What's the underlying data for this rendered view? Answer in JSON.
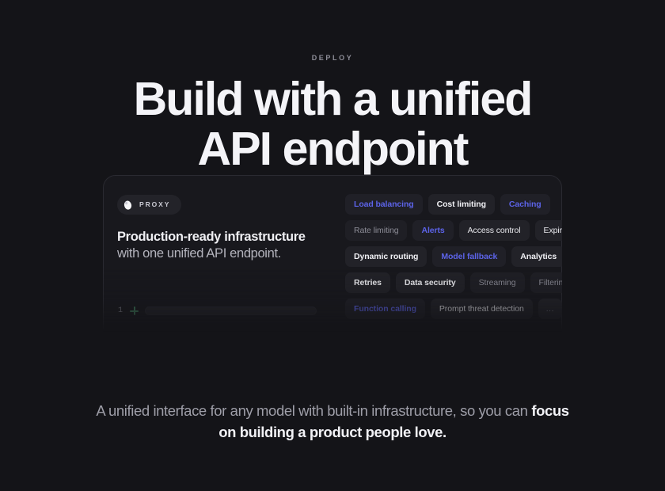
{
  "hero": {
    "eyebrow": "DEPLOY",
    "title_line1": "Build with a unified",
    "title_line2": "API endpoint"
  },
  "card": {
    "brand": {
      "mark_icon": "egg-logo-icon",
      "name": "PROXY"
    },
    "headline_line1": "Production-ready infrastructure",
    "headline_line2": "with one unified API endpoint.",
    "composer": {
      "count": "1",
      "add_icon": "plus-icon",
      "input_placeholder": ""
    },
    "chip_rows": [
      [
        {
          "label": "Load balancing",
          "style": "t-blue"
        },
        {
          "label": "Cost limiting",
          "style": "t-bright"
        },
        {
          "label": "Caching",
          "style": "t-blue"
        }
      ],
      [
        {
          "label": "Rate limiting",
          "style": "t-dim"
        },
        {
          "label": "Alerts",
          "style": "t-blue"
        },
        {
          "label": "Access control",
          "style": "t-white"
        },
        {
          "label": "Expiry",
          "style": "t-white"
        }
      ],
      [
        {
          "label": "Dynamic routing",
          "style": "t-bright"
        },
        {
          "label": "Model fallback",
          "style": "t-blue"
        },
        {
          "label": "Analytics",
          "style": "t-bright"
        }
      ],
      [
        {
          "label": "Retries",
          "style": "t-bright"
        },
        {
          "label": "Data security",
          "style": "t-bright"
        },
        {
          "label": "Streaming",
          "style": "t-dim"
        },
        {
          "label": "Filtering",
          "style": "t-dim"
        }
      ],
      [
        {
          "label": "Function calling",
          "style": "t-blue"
        },
        {
          "label": "Prompt threat detection",
          "style": "t-white"
        },
        {
          "label": "...",
          "style": "t-more"
        }
      ]
    ]
  },
  "footer": {
    "text_dim_1": "A unified interface for any model with built-in infrastructure, so you can ",
    "text_bold": "focus on building a product people love."
  },
  "colors": {
    "page_background": "#141418",
    "card_background": "#18181d",
    "card_border": "#2a2a31",
    "chip_background": "#222228",
    "accent_blue": "#5c63e8",
    "accent_green": "#3f7d5c",
    "text_primary": "#f4f4f8",
    "text_muted": "#9e9ea8"
  }
}
